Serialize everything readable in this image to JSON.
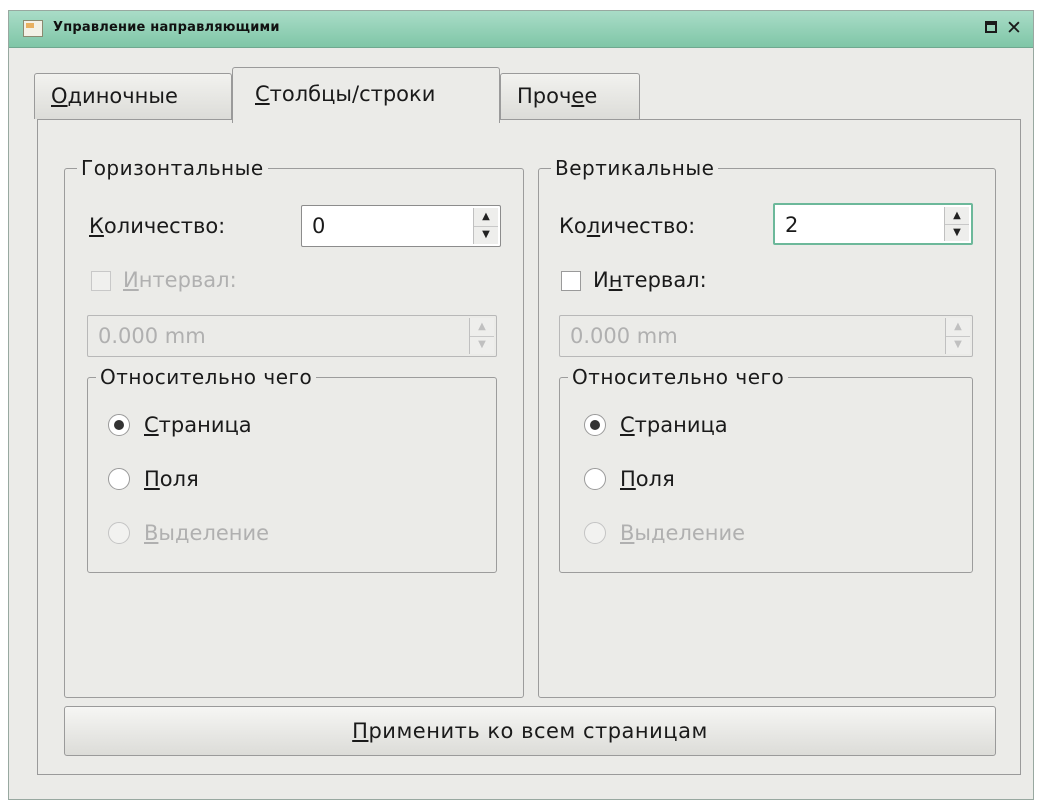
{
  "window": {
    "title": "Управление направляющими",
    "maximize_icon": "maximize-icon",
    "close_icon": "close-icon",
    "close_glyph": "✕"
  },
  "tabs": [
    {
      "first": "О",
      "rest": "диночные",
      "active": false
    },
    {
      "first": "С",
      "rest": "толбцы/строки",
      "active": true
    },
    {
      "pre": "Проч",
      "ul": "е",
      "post": "е",
      "active": false
    }
  ],
  "horizontal": {
    "title": "Горизонтальные",
    "count_label_first": "К",
    "count_label_rest": "оличество:",
    "count_value": "0",
    "interval_first": "И",
    "interval_rest": "нтервал:",
    "interval_checked": false,
    "interval_enabled": false,
    "interval_value": "0.000 mm",
    "relative": {
      "title": "Относительно чего",
      "options": [
        {
          "first": "С",
          "rest": "траница",
          "checked": true,
          "enabled": true
        },
        {
          "first": "П",
          "rest": "оля",
          "checked": false,
          "enabled": true
        },
        {
          "first": "В",
          "rest": "ыделение",
          "checked": false,
          "enabled": false
        }
      ]
    }
  },
  "vertical": {
    "title": "Вертикальные",
    "count_label_pre": "Ко",
    "count_label_ul": "л",
    "count_label_post": "ичество:",
    "count_value": "2",
    "interval_pre": "И",
    "interval_ul": "н",
    "interval_post": "тервал:",
    "interval_checked": false,
    "interval_enabled": true,
    "interval_value": "0.000 mm",
    "relative": {
      "title": "Относительно чего",
      "options": [
        {
          "first": "С",
          "rest": "траница",
          "checked": true,
          "enabled": true
        },
        {
          "first": "П",
          "rest": "оля",
          "checked": false,
          "enabled": true
        },
        {
          "first": "В",
          "rest": "ыделение",
          "checked": false,
          "enabled": false
        }
      ]
    }
  },
  "apply_button": {
    "first": "П",
    "rest": "рименить ко всем страницам"
  },
  "colors": {
    "titlebar": "#8fd0b5",
    "focus": "#6cb89a"
  }
}
